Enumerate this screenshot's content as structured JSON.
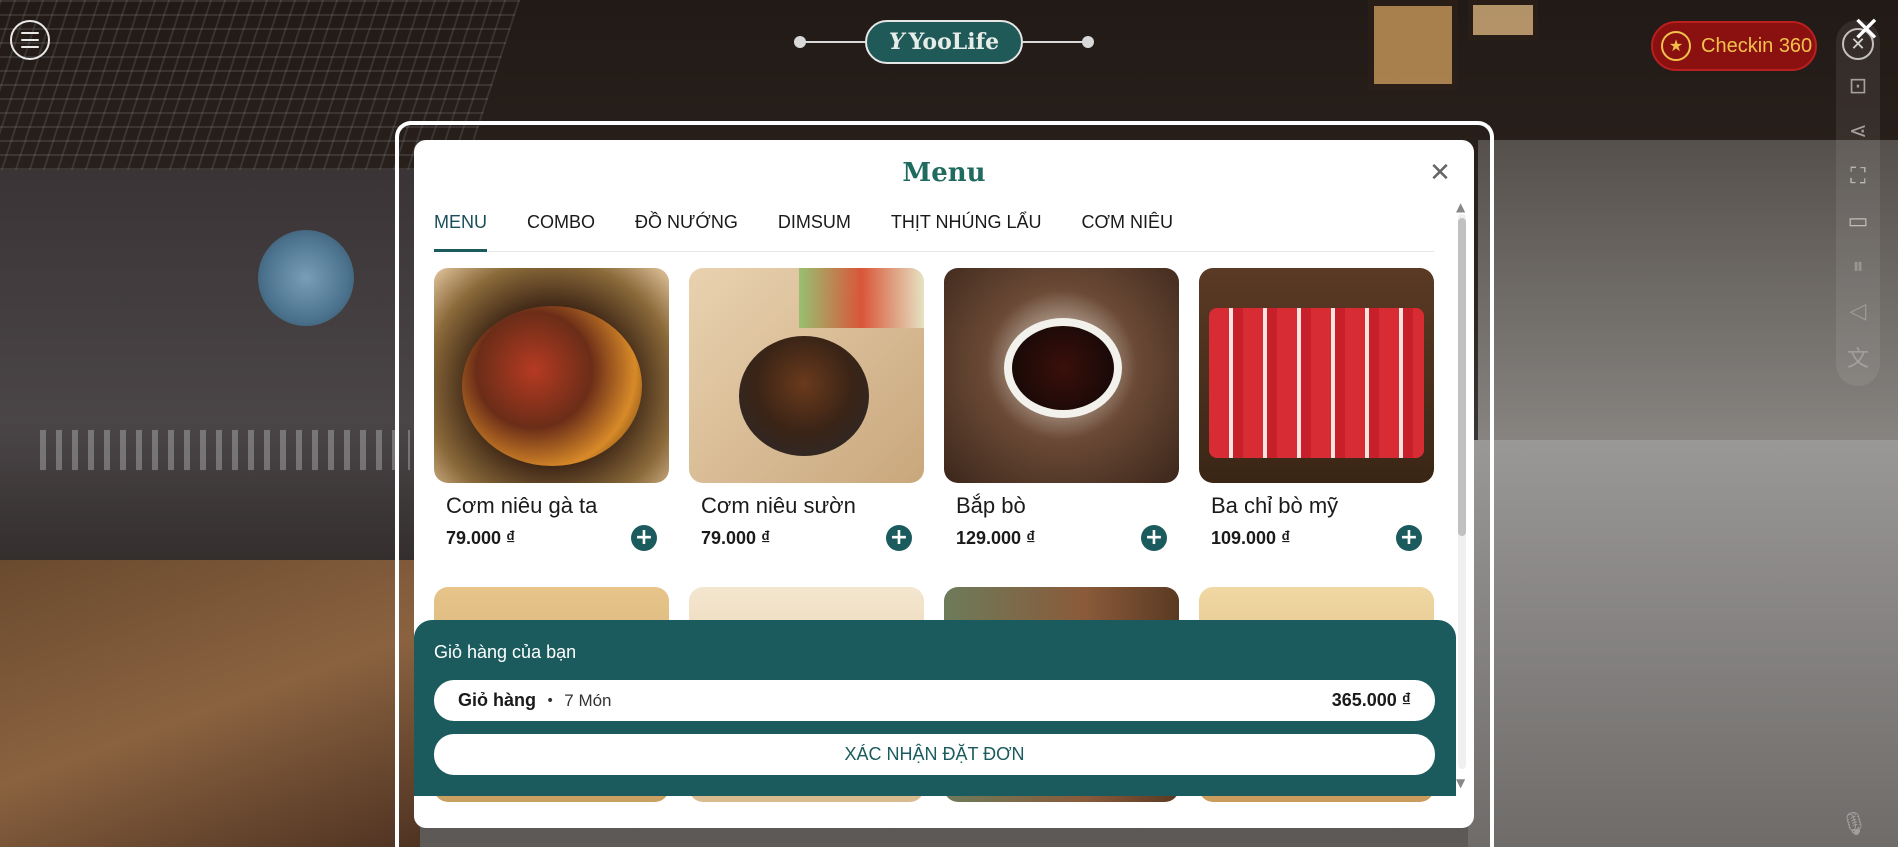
{
  "brand": {
    "logo_text": "YooLife"
  },
  "checkin": {
    "label": "Checkin 360"
  },
  "modal": {
    "title": "Menu",
    "tabs": [
      {
        "label": "MENU",
        "active": true
      },
      {
        "label": "COMBO",
        "active": false
      },
      {
        "label": "ĐỒ NƯỚNG",
        "active": false
      },
      {
        "label": "DIMSUM",
        "active": false
      },
      {
        "label": "THỊT NHÚNG LẨU",
        "active": false
      },
      {
        "label": "CƠM NIÊU",
        "active": false
      }
    ],
    "items": [
      {
        "name": "Cơm niêu gà ta",
        "price": "79.000 ₫"
      },
      {
        "name": "Cơm niêu sườn",
        "price": "79.000 ₫"
      },
      {
        "name": "Bắp bò",
        "price": "129.000 ₫"
      },
      {
        "name": "Ba chỉ bò mỹ",
        "price": "109.000 ₫"
      }
    ]
  },
  "cart": {
    "title": "Giỏ hàng của bạn",
    "label": "Giỏ hàng",
    "count": "7 Món",
    "total": "365.000 ₫",
    "confirm_label": "XÁC NHẬN ĐẶT ĐƠN"
  },
  "colors": {
    "primary": "#1b5b5d",
    "title": "#1f6b5f",
    "checkin_bg": "#8b1111",
    "checkin_text": "#f1c14b"
  },
  "icons": {
    "toolbar": [
      "close-icon",
      "vr-headset-icon",
      "share-icon",
      "fullscreen-icon",
      "video-icon",
      "pause-icon",
      "mute-icon",
      "translate-icon"
    ]
  }
}
